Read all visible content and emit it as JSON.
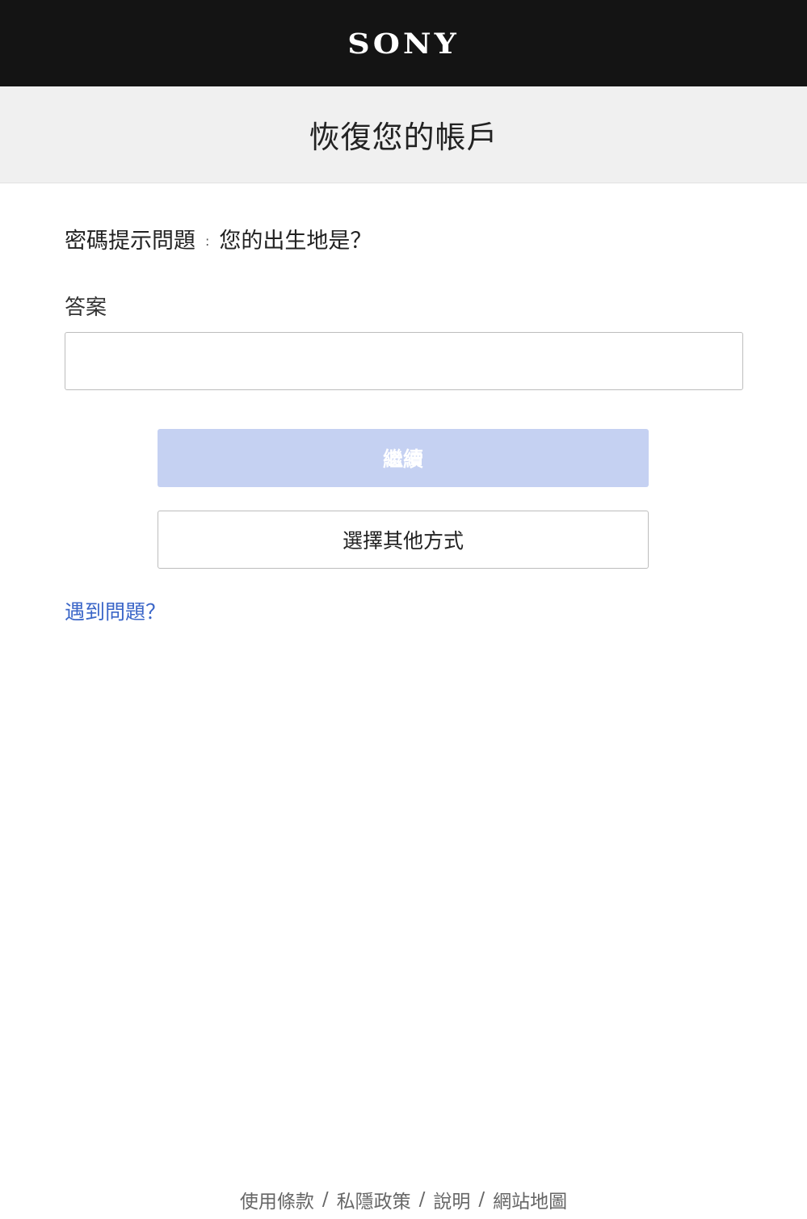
{
  "header": {
    "logo_text": "SONY",
    "bg_color": "#141414"
  },
  "title_band": {
    "title": "恢復您的帳戶"
  },
  "form": {
    "question_label": "密碼提示問題",
    "question_colon": ":",
    "question_text": "您的出生地是？",
    "answer_label": "答案",
    "answer_value": "",
    "continue_label": "繼續",
    "continue_color": "#c5d1f2",
    "other_method_label": "選擇其他方式",
    "trouble_link": "遇到問題？",
    "link_color": "#3b66c8"
  },
  "footer": {
    "links": [
      "使用條款",
      "私隱政策",
      "說明",
      "網站地圖"
    ],
    "separator": "/"
  }
}
